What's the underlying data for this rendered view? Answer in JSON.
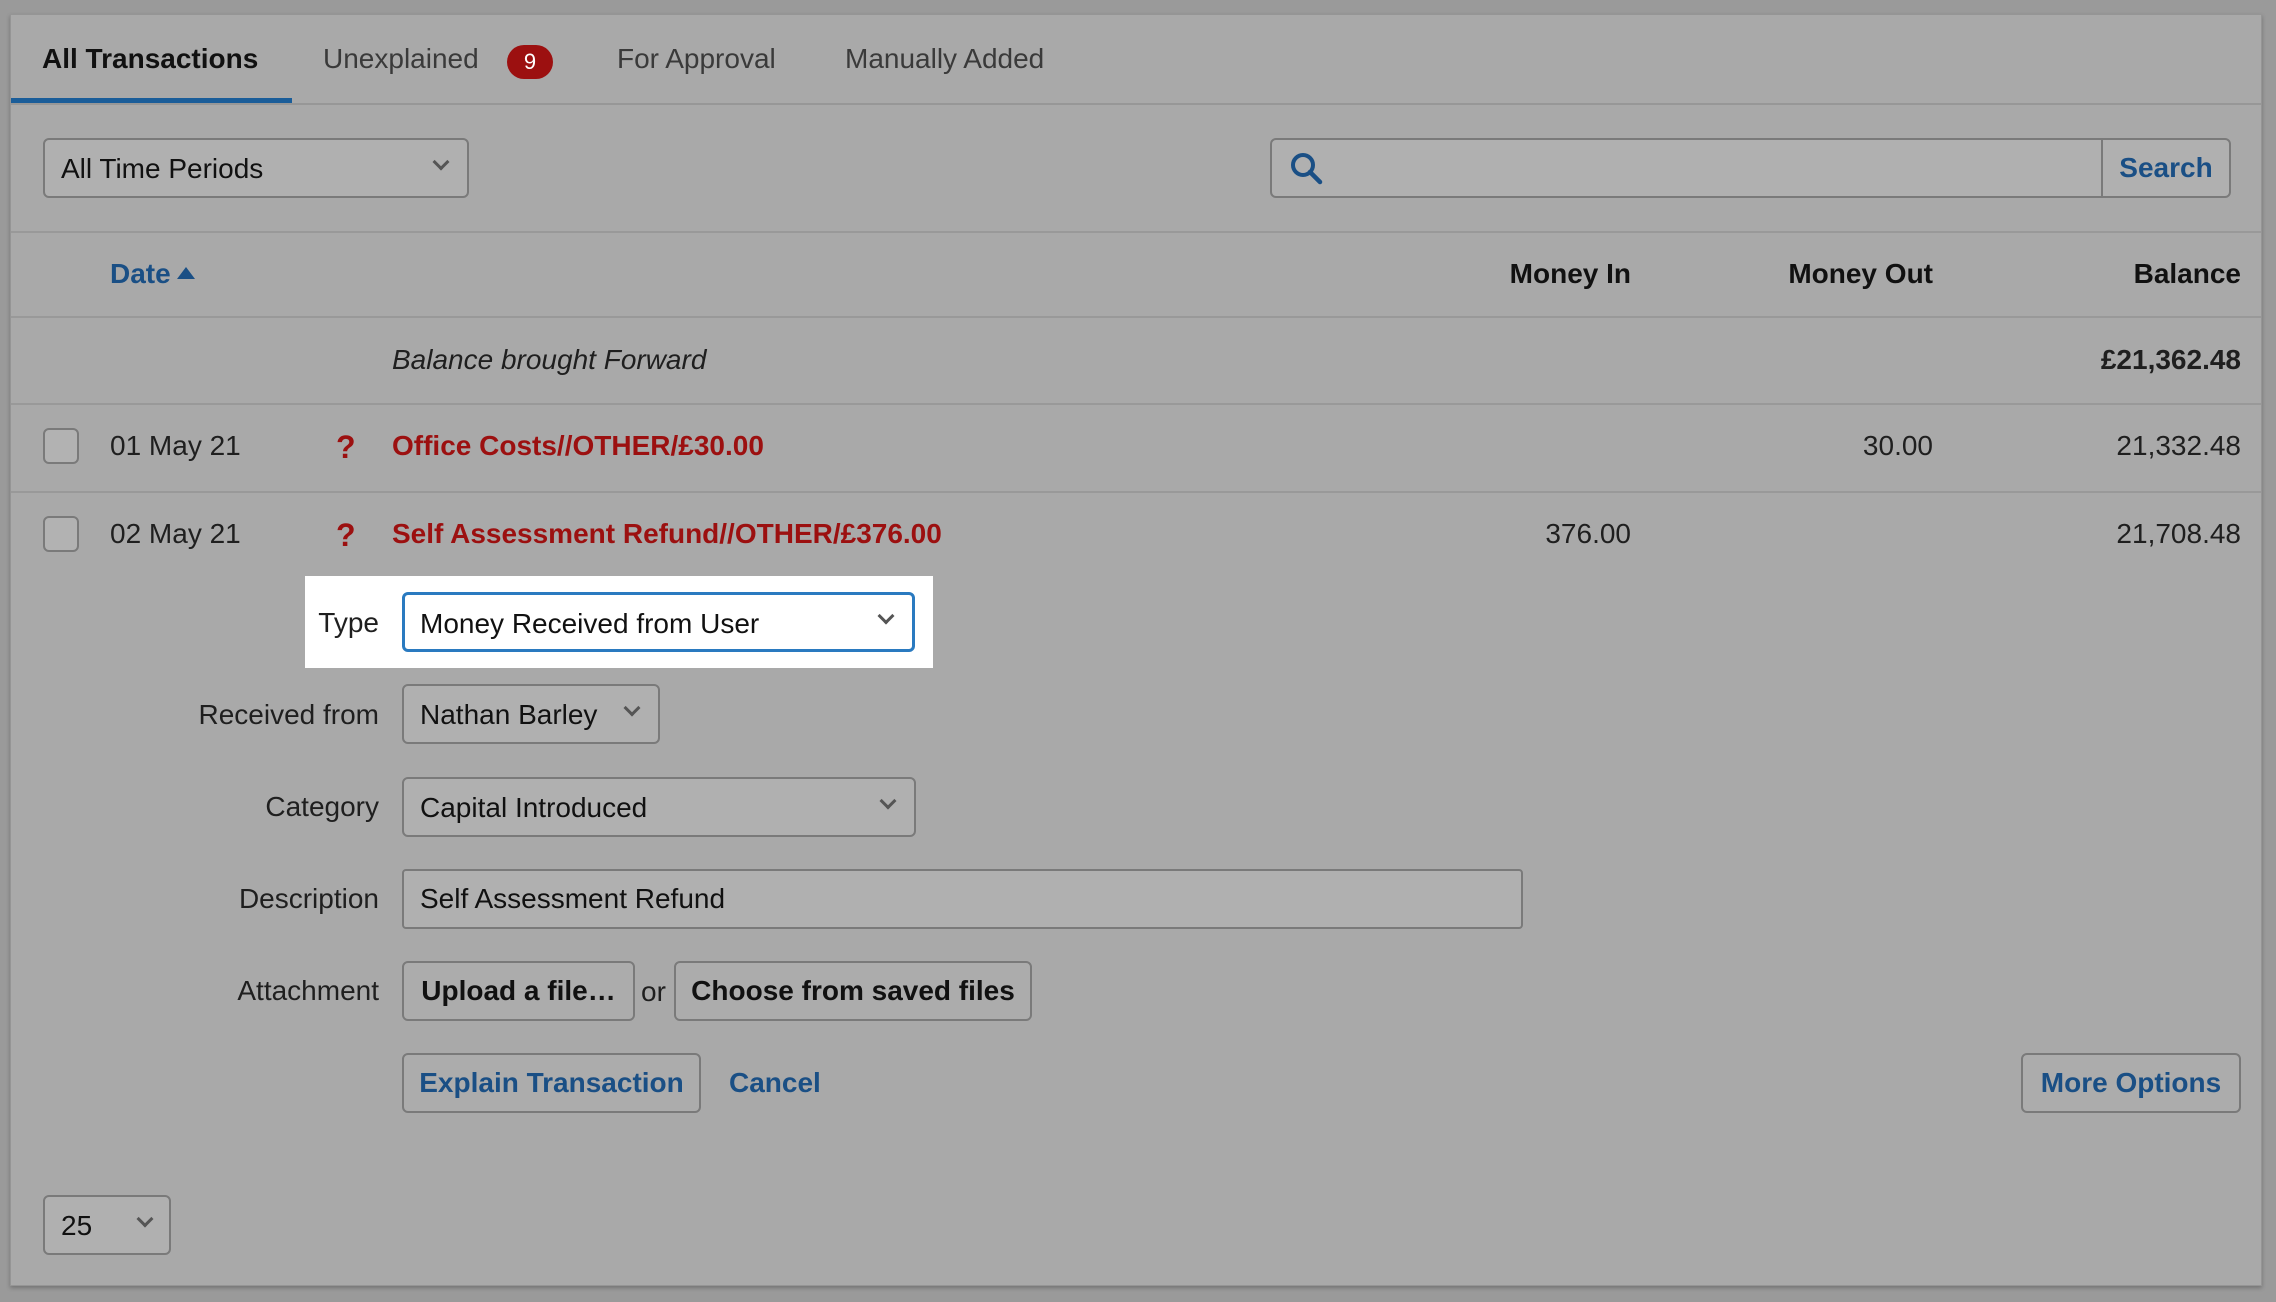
{
  "tabs": [
    {
      "label": "All Transactions",
      "active": true
    },
    {
      "label": "Unexplained",
      "badge": "9"
    },
    {
      "label": "For Approval"
    },
    {
      "label": "Manually Added"
    }
  ],
  "toolbar": {
    "period_select": "All Time Periods",
    "search_placeholder": "",
    "search_button": "Search"
  },
  "table": {
    "headers": {
      "date": "Date",
      "money_in": "Money In",
      "money_out": "Money Out",
      "balance": "Balance"
    },
    "brought_forward": {
      "label": "Balance brought Forward",
      "balance": "£21,362.48"
    },
    "rows": [
      {
        "date": "01 May 21",
        "description": "Office Costs//OTHER/£30.00",
        "money_in": "",
        "money_out": "30.00",
        "balance": "21,332.48"
      },
      {
        "date": "02 May 21",
        "description": "Self Assessment Refund//OTHER/£376.00",
        "money_in": "376.00",
        "money_out": "",
        "balance": "21,708.48"
      }
    ]
  },
  "form": {
    "type_label": "Type",
    "type_value": "Money Received from User",
    "received_from_label": "Received from",
    "received_from_value": "Nathan Barley",
    "category_label": "Category",
    "category_value": "Capital Introduced",
    "description_label": "Description",
    "description_value": "Self Assessment Refund",
    "attachment_label": "Attachment",
    "upload_button": "Upload a file…",
    "or_text": "or",
    "choose_button": "Choose from saved files",
    "explain_button": "Explain Transaction",
    "cancel_link": "Cancel",
    "more_options_button": "More Options"
  },
  "pagination": {
    "per_page": "25"
  },
  "colors": {
    "accent": "#1a5d99",
    "link": "#1a4f85",
    "alert": "#9c1010",
    "focus": "#2a7ac0"
  }
}
